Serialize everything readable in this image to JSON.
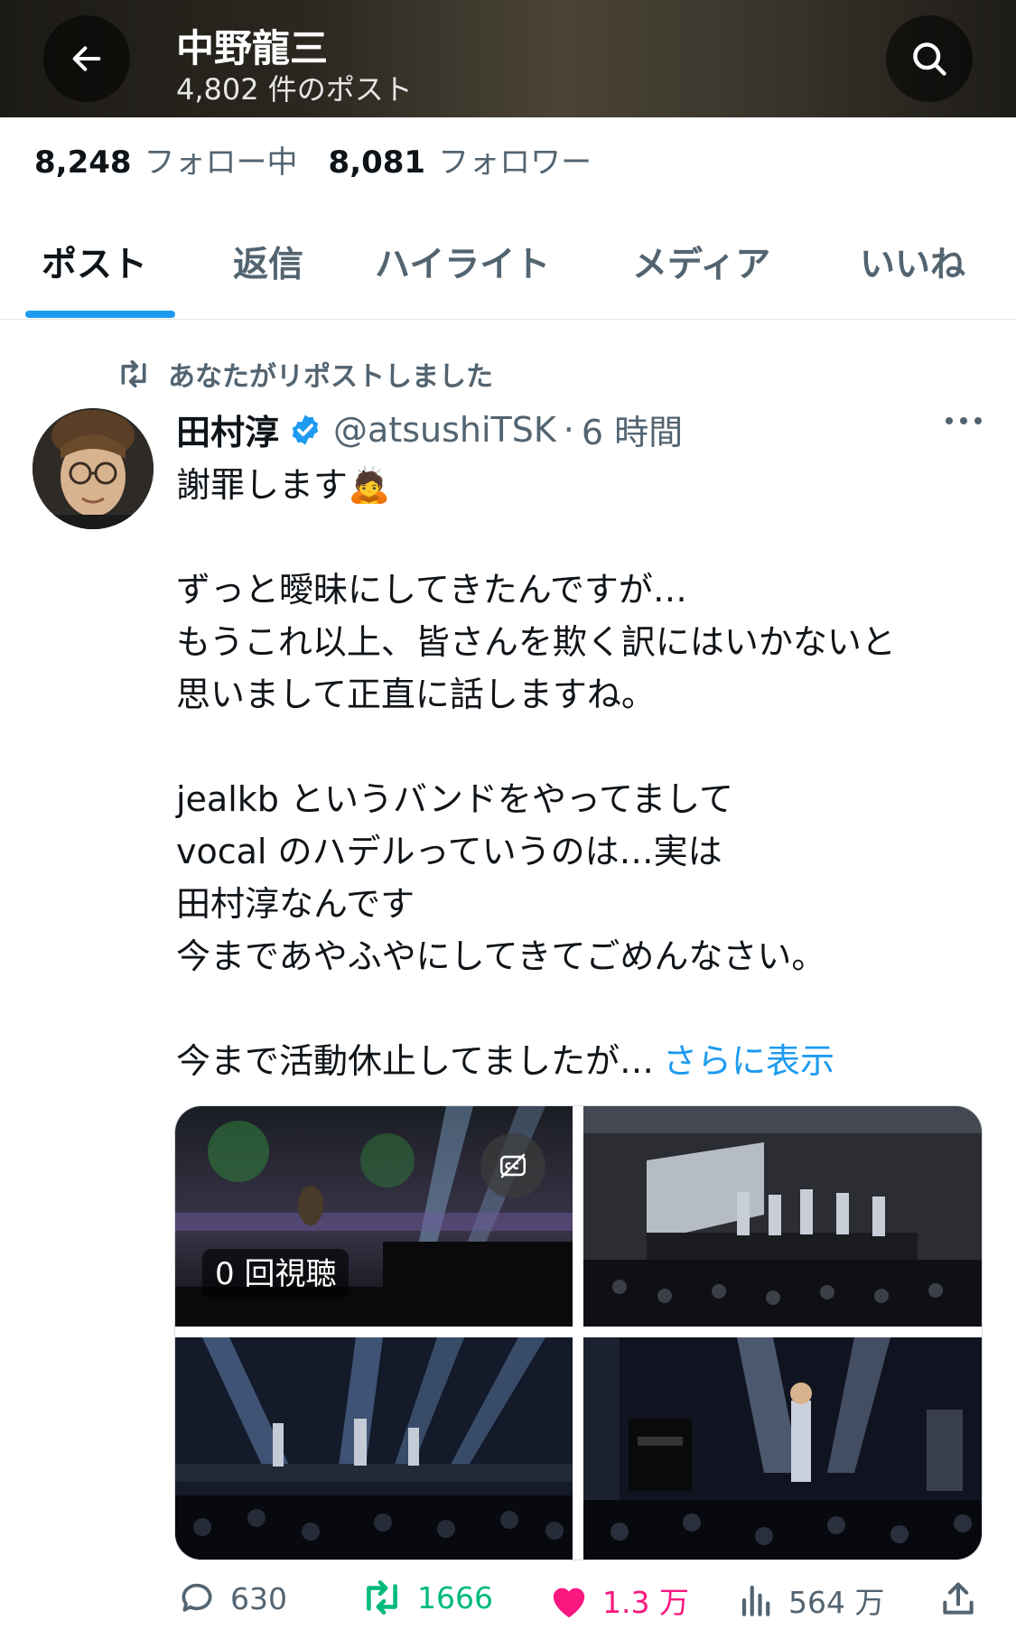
{
  "header": {
    "title": "中野龍三",
    "post_count": "4,802 件のポスト"
  },
  "stats": {
    "following_count": "8,248",
    "following_label": "フォロー中",
    "followers_count": "8,081",
    "followers_label": "フォロワー"
  },
  "tabs": [
    {
      "label": "ポスト",
      "active": true
    },
    {
      "label": "返信",
      "active": false
    },
    {
      "label": "ハイライト",
      "active": false
    },
    {
      "label": "メディア",
      "active": false
    },
    {
      "label": "いいね",
      "active": false
    }
  ],
  "post": {
    "repost_label": "あなたがリポストしました",
    "author_name": "田村淳",
    "handle": "@atsushiTSK",
    "separator": "·",
    "time": "6 時間",
    "text_lines": [
      "謝罪します🙇",
      "",
      "ずっと曖昧にしてきたんですが…",
      "もうこれ以上、皆さんを欺く訳にはいかないと",
      "思いまして正直に話しますね。",
      "",
      "jealkb というバンドをやってまして",
      "vocal のハデルっていうのは…実は",
      "田村淳なんです",
      "今まであやふやにしてきてごめんなさい。",
      "",
      "今まで活動休止してましたが…"
    ],
    "show_more": "さらに表示",
    "media": {
      "video_views": "0 回視聴"
    },
    "actions": {
      "replies": "630",
      "reposts": "1666",
      "likes": "1.3 万",
      "views": "564 万"
    }
  },
  "colors": {
    "accent": "#1d9bf0",
    "repost_green": "#00ba7c",
    "like_pink": "#f91880",
    "muted": "#536471"
  }
}
